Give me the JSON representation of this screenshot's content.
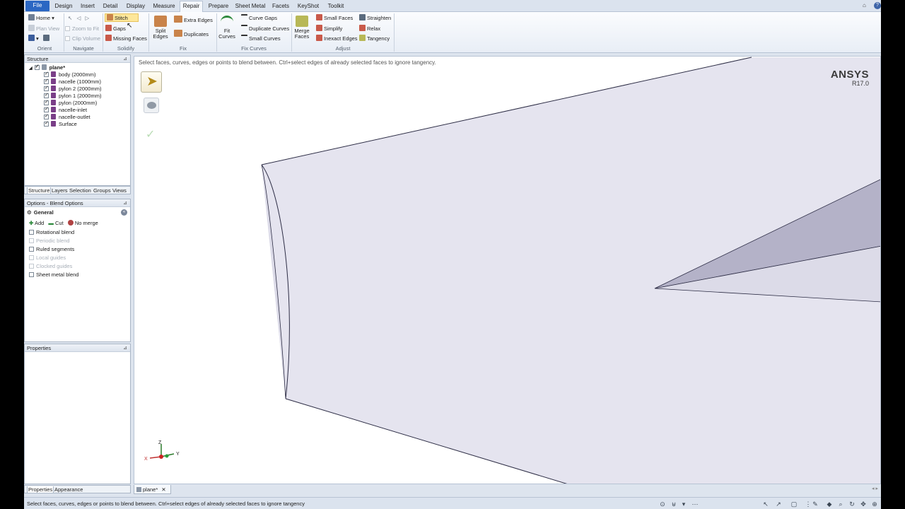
{
  "tabs": [
    "File",
    "Design",
    "Insert",
    "Detail",
    "Display",
    "Measure",
    "Repair",
    "Prepare",
    "Sheet Metal",
    "Facets",
    "KeyShot",
    "Toolkit"
  ],
  "active_tab": "Repair",
  "ribbon": {
    "orient": {
      "home": "Home",
      "plan_view": "Plan View",
      "label": "Orient"
    },
    "navigate": {
      "zoom_to_fit": "Zoom to Fit",
      "clip_volume": "Clip Volume",
      "label": "Navigate"
    },
    "solidify": {
      "stitch": "Stitch",
      "gaps": "Gaps",
      "missing_faces": "Missing Faces",
      "label": "Solidify"
    },
    "fix": {
      "split_edges": "Split\nEdges",
      "extra_edges": "Extra Edges",
      "duplicates": "Duplicates",
      "label": "Fix"
    },
    "fix_curves": {
      "fit_curves": "Fit\nCurves",
      "curve_gaps": "Curve Gaps",
      "duplicate_curves": "Duplicate Curves",
      "small_curves": "Small Curves",
      "label": "Fix Curves"
    },
    "adjust": {
      "merge_faces": "Merge\nFaces",
      "small_faces": "Small Faces",
      "simplify": "Simplify",
      "inexact_edges": "Inexact Edges",
      "straighten": "Straighten",
      "relax": "Relax",
      "tangency": "Tangency",
      "label": "Adjust"
    }
  },
  "structure": {
    "title": "Structure",
    "root": "plane*",
    "items": [
      "body (2000mm)",
      "nacelle (1000mm)",
      "pylon 2 (2000mm)",
      "pylon 1 (2000mm)",
      "pylon (2000mm)",
      "nacelle-inlet",
      "nacelle-outlet",
      "Surface"
    ]
  },
  "panel_tabs": [
    "Structure",
    "Layers",
    "Selection",
    "Groups",
    "Views"
  ],
  "options": {
    "title": "Options - Blend Options",
    "section": "General",
    "modes": [
      "Add",
      "Cut",
      "No merge"
    ],
    "checks": [
      {
        "label": "Rotational blend",
        "enabled": true
      },
      {
        "label": "Periodic blend",
        "enabled": false
      },
      {
        "label": "Ruled segments",
        "enabled": true
      },
      {
        "label": "Local guides",
        "enabled": false
      },
      {
        "label": "Clocked guides",
        "enabled": false
      },
      {
        "label": "Sheet metal blend",
        "enabled": true
      }
    ]
  },
  "properties": {
    "title": "Properties"
  },
  "bottom_left_tabs": [
    "Properties",
    "Appearance"
  ],
  "viewport": {
    "prompt": "Select faces, curves, edges or points to blend between. Ctrl+select edges of already selected faces to ignore tangency.",
    "brand": "ANSYS",
    "version": "R17.0",
    "triad": {
      "x": "X",
      "y": "Y",
      "z": "Z"
    }
  },
  "doc_tab": "plane*",
  "status_text": "Select faces, curves, edges or points to blend between. Ctrl+select edges of already selected faces to ignore tangency",
  "colors": {
    "file_tab": "#2b67c3",
    "highlight": "#fde79a",
    "body_icon": "#7a3f88",
    "wing_face": "#e5e4ef",
    "wing_edge": "#2c2c44"
  }
}
